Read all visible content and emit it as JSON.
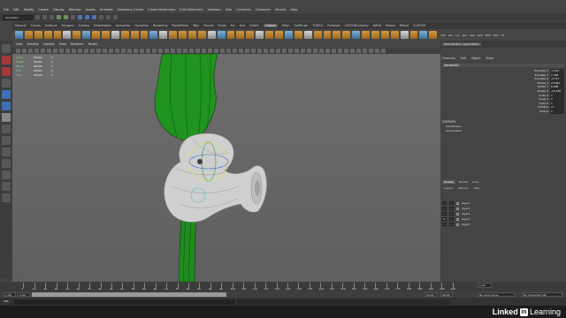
{
  "menubar": [
    "File",
    "Edit",
    "Modify",
    "Create",
    "Display",
    "Window",
    "Assets",
    "Animate",
    "Geometry Cache",
    "Create Deformers",
    "Edit Deformers",
    "Skeleton",
    "Skin",
    "Constrain",
    "Character",
    "Muscle",
    "Help"
  ],
  "status": {
    "workspace": "Animation"
  },
  "shelf_tabs": [
    "General",
    "Curves",
    "Surfaces",
    "Polygons",
    "Subdivs",
    "Deformation",
    "Animation",
    "Dynamics",
    "Rendering",
    "PaintEffects",
    "Toon",
    "Muscle",
    "Fluids",
    "Fur",
    "Hair",
    "nCloth",
    "Custom",
    "XGen",
    "GoZBrush",
    "TURTLE",
    "Pulldown",
    "CUSTOM:\\Library",
    "MASH",
    "Motion",
    "Bifrost",
    "CUSTOM"
  ],
  "shelf_tab_active": "Custom",
  "shelf_right": [
    "c1B",
    "cRs",
    "1/1",
    "pk1",
    "pk2",
    "pk3",
    "MOT",
    "RIG",
    "FX"
  ],
  "viewport": {
    "menu": [
      "View",
      "Shading",
      "Lighting",
      "Show",
      "Renderer",
      "Panels"
    ],
    "hud": [
      {
        "label": "Verts:",
        "v1": "66090",
        "v2": "0"
      },
      {
        "label": "Edges:",
        "v1": "66080",
        "v2": "0"
      },
      {
        "label": "Faces:",
        "v1": "66090",
        "v2": "0"
      },
      {
        "label": "Tris:",
        "v1": "66090",
        "v2": "0"
      },
      {
        "label": "UVs:",
        "v1": "66090",
        "v2": "0"
      }
    ]
  },
  "channel_box": {
    "tabs": [
      "Channel Box / Layer Editor"
    ],
    "menu": [
      "Channels",
      "Edit",
      "Object",
      "Show"
    ],
    "object_name": "Handle002",
    "attrs": [
      {
        "name": "Translate X",
        "value": "-1.197"
      },
      {
        "name": "Translate Y",
        "value": "1.338"
      },
      {
        "name": "Translate Z",
        "value": "-0.717"
      },
      {
        "name": "Rotate X",
        "value": "23.904"
      },
      {
        "name": "Rotate Y",
        "value": "6.908"
      },
      {
        "name": "Rotate Z",
        "value": "-10.186"
      },
      {
        "name": "Scale X",
        "value": "1"
      },
      {
        "name": "Scale Y",
        "value": "1"
      },
      {
        "name": "Scale Z",
        "value": "1"
      },
      {
        "name": "Visibility",
        "value": "on"
      },
      {
        "name": "Radius",
        "value": "1"
      }
    ],
    "inputs_label": "OUTPUTS",
    "inputs": [
      "blendPose1",
      "skinCluster1"
    ]
  },
  "layers": {
    "tabs": [
      "Display",
      "Render",
      "Anim"
    ],
    "menu": [
      "Layers",
      "Options",
      "Help"
    ],
    "items": [
      {
        "v": "",
        "name": "layer4"
      },
      {
        "v": "",
        "name": "layer3"
      },
      {
        "v": "",
        "name": "layer2"
      },
      {
        "v": "V",
        "name": "layer1"
      },
      {
        "v": "",
        "name": "layer1"
      }
    ]
  },
  "timeline": {
    "ticks": [
      "5",
      "10",
      "15",
      "20",
      "25",
      "30",
      "35",
      "40",
      "45",
      "50",
      "55",
      "60",
      "65",
      "70",
      "75",
      "80",
      "85",
      "90",
      "95",
      "100",
      "105",
      "110",
      "115",
      "120",
      "125",
      "130",
      "135",
      "140",
      "145",
      "150",
      "155",
      "160",
      "165",
      "170",
      "175",
      "180",
      "185",
      "190",
      "195",
      "200"
    ],
    "current_frame": "1.00",
    "start": "1.00",
    "start2": "1.00",
    "end": "24.00",
    "end2": "48.00",
    "anim_layer": "No Anim Layer",
    "char_set": "No Character Set"
  },
  "cmd": {
    "label": "MEL"
  },
  "branding": {
    "name": "Linked",
    "box": "in",
    "suffix": "Learning"
  },
  "colors": {
    "leaf_green": "#1e8c1e",
    "handle": "#d0d0d0",
    "viewport_bg": "#666666"
  }
}
